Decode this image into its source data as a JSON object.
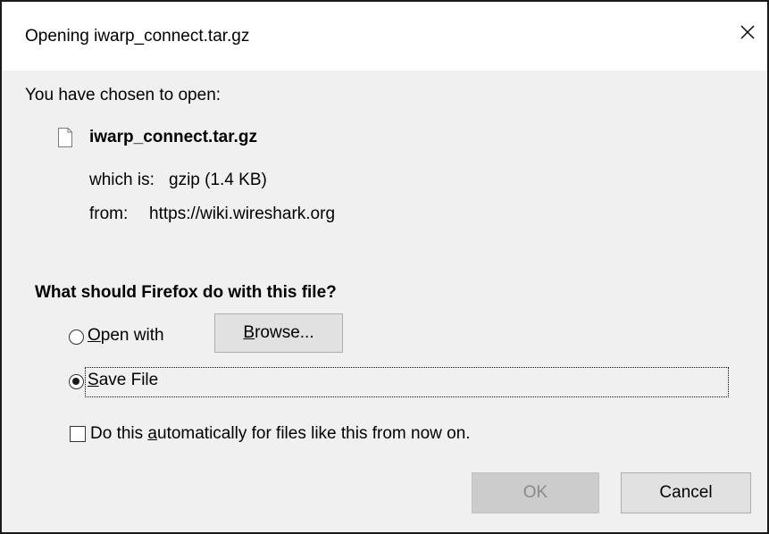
{
  "dialog": {
    "title": "Opening iwarp_connect.tar.gz",
    "close_glyph": "✕"
  },
  "info": {
    "intro": "You have chosen to open:",
    "file_name": "iwarp_connect.tar.gz",
    "which_is_label": "which is:",
    "which_is_value": "gzip (1.4 KB)",
    "from_label": "from:",
    "from_value": "https://wiki.wireshark.org"
  },
  "action": {
    "question": "What should Firefox do with this file?",
    "open_with_label_accel": "O",
    "open_with_label_rest": "pen with",
    "browse_accel": "B",
    "browse_rest": "rowse...",
    "save_file_accel": "S",
    "save_file_rest": "ave File",
    "selected": "save_file"
  },
  "auto": {
    "label_pre": "Do this ",
    "label_accel": "a",
    "label_post": "utomatically for files like this from now on.",
    "checked": false
  },
  "buttons": {
    "ok": "OK",
    "cancel": "Cancel"
  }
}
